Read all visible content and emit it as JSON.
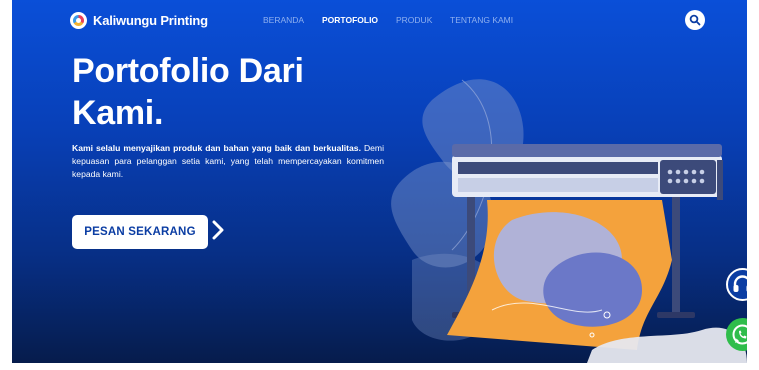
{
  "brand": {
    "name": "Kaliwungu Printing"
  },
  "nav": {
    "items": [
      {
        "label": "BERANDA",
        "active": false
      },
      {
        "label": "PORTOFOLIO",
        "active": true
      },
      {
        "label": "PRODUK",
        "active": false
      },
      {
        "label": "TENTANG KAMI",
        "active": false
      }
    ]
  },
  "hero": {
    "title_line1": "Portofolio Dari",
    "title_line2": "Kami.",
    "desc_bold": "Kami selalu menyajikan produk dan bahan yang baik dan berkualitas.",
    "desc_rest": " Demi kepuasan para pelanggan setia kami, yang telah mempercayakan komitmen kepada kami.",
    "cta_label": "PESAN SEKARANG"
  },
  "icons": {
    "search": "search-icon",
    "cta_arrow": "chevron-right-icon",
    "support": "headset-icon",
    "whatsapp": "whatsapp-icon"
  },
  "colors": {
    "hero_top": "#0a4fd8",
    "hero_bottom": "#061c4c",
    "nav_inactive": "#8fb0ef",
    "cta_text": "#0b3da3",
    "whatsapp": "#2fbd4b"
  }
}
